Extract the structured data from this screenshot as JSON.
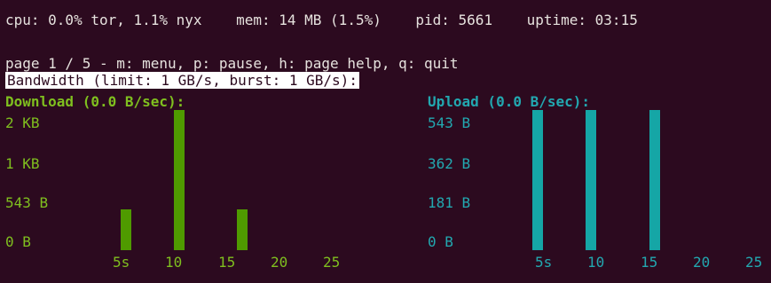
{
  "status": {
    "text": "cpu: 0.0% tor, 1.1% nyx    mem: 14 MB (1.5%)    pid: 5661    uptime: 03:15"
  },
  "page_line": "page 1 / 5 - m: menu, p: pause, h: page help, q: quit",
  "bandwidth_header": "Bandwidth (limit: 1 GB/s, burst: 1 GB/s):",
  "download": {
    "title": "Download (0.0 B/sec):",
    "y_labels": [
      "2 KB",
      "1 KB",
      "543 B",
      "0 B"
    ],
    "x_labels": [
      "5s",
      "10",
      "15",
      "20",
      "25"
    ],
    "bars": [
      0.29,
      1.0,
      0.29
    ]
  },
  "upload": {
    "title": "Upload (0.0 B/sec):",
    "y_labels": [
      "543 B",
      "362 B",
      "181 B",
      "0 B"
    ],
    "x_labels": [
      "5s",
      "10",
      "15",
      "20",
      "25"
    ],
    "bars": [
      1.0,
      1.0,
      1.0
    ]
  },
  "colors": {
    "background": "#2c0a1f",
    "download": "#7fbf1f",
    "download_bar": "#4f9a00",
    "upload": "#22a8b0",
    "upload_bar": "#15a6a6"
  }
}
